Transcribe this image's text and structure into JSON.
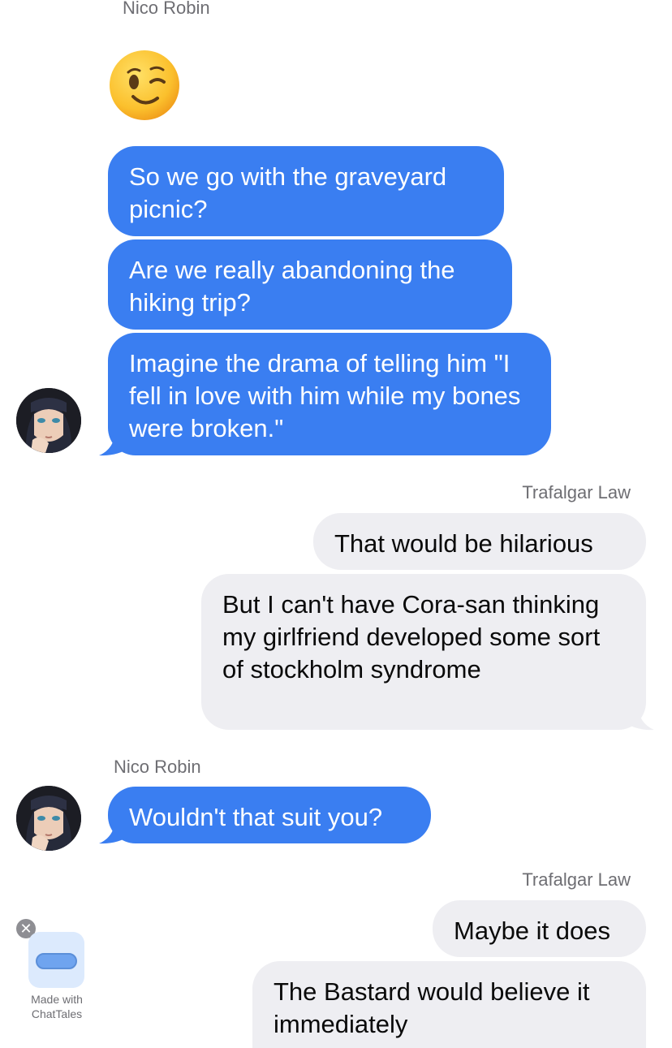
{
  "colors": {
    "incoming_bubble": "#3a7ef1",
    "outgoing_bubble": "#eeeef2",
    "sender_label": "#6e6e73"
  },
  "messages": [
    {
      "sender": "Nico Robin",
      "type": "emoji",
      "text": "😉"
    },
    {
      "type": "text",
      "text": "So we go with the graveyard picnic?"
    },
    {
      "type": "text",
      "text": "Are we really abandoning the hiking trip?"
    },
    {
      "type": "text",
      "text": "Imagine the drama of telling him \"I fell in love with him while my bones were broken.\""
    },
    {
      "sender": "Trafalgar Law",
      "type": "text",
      "text": "That would be hilarious"
    },
    {
      "type": "text",
      "text": "But I can't have Cora-san thinking my girlfriend developed some sort of stockholm syndrome"
    },
    {
      "sender": "Nico Robin",
      "type": "text",
      "text": "Wouldn't that suit you?"
    },
    {
      "sender": "Trafalgar Law",
      "type": "text",
      "text": "Maybe it does"
    },
    {
      "type": "text",
      "text": "The Bastard would believe it immediately"
    }
  ],
  "badge": {
    "line1": "Made with",
    "line2": "ChatTales",
    "close_glyph": "✕"
  }
}
